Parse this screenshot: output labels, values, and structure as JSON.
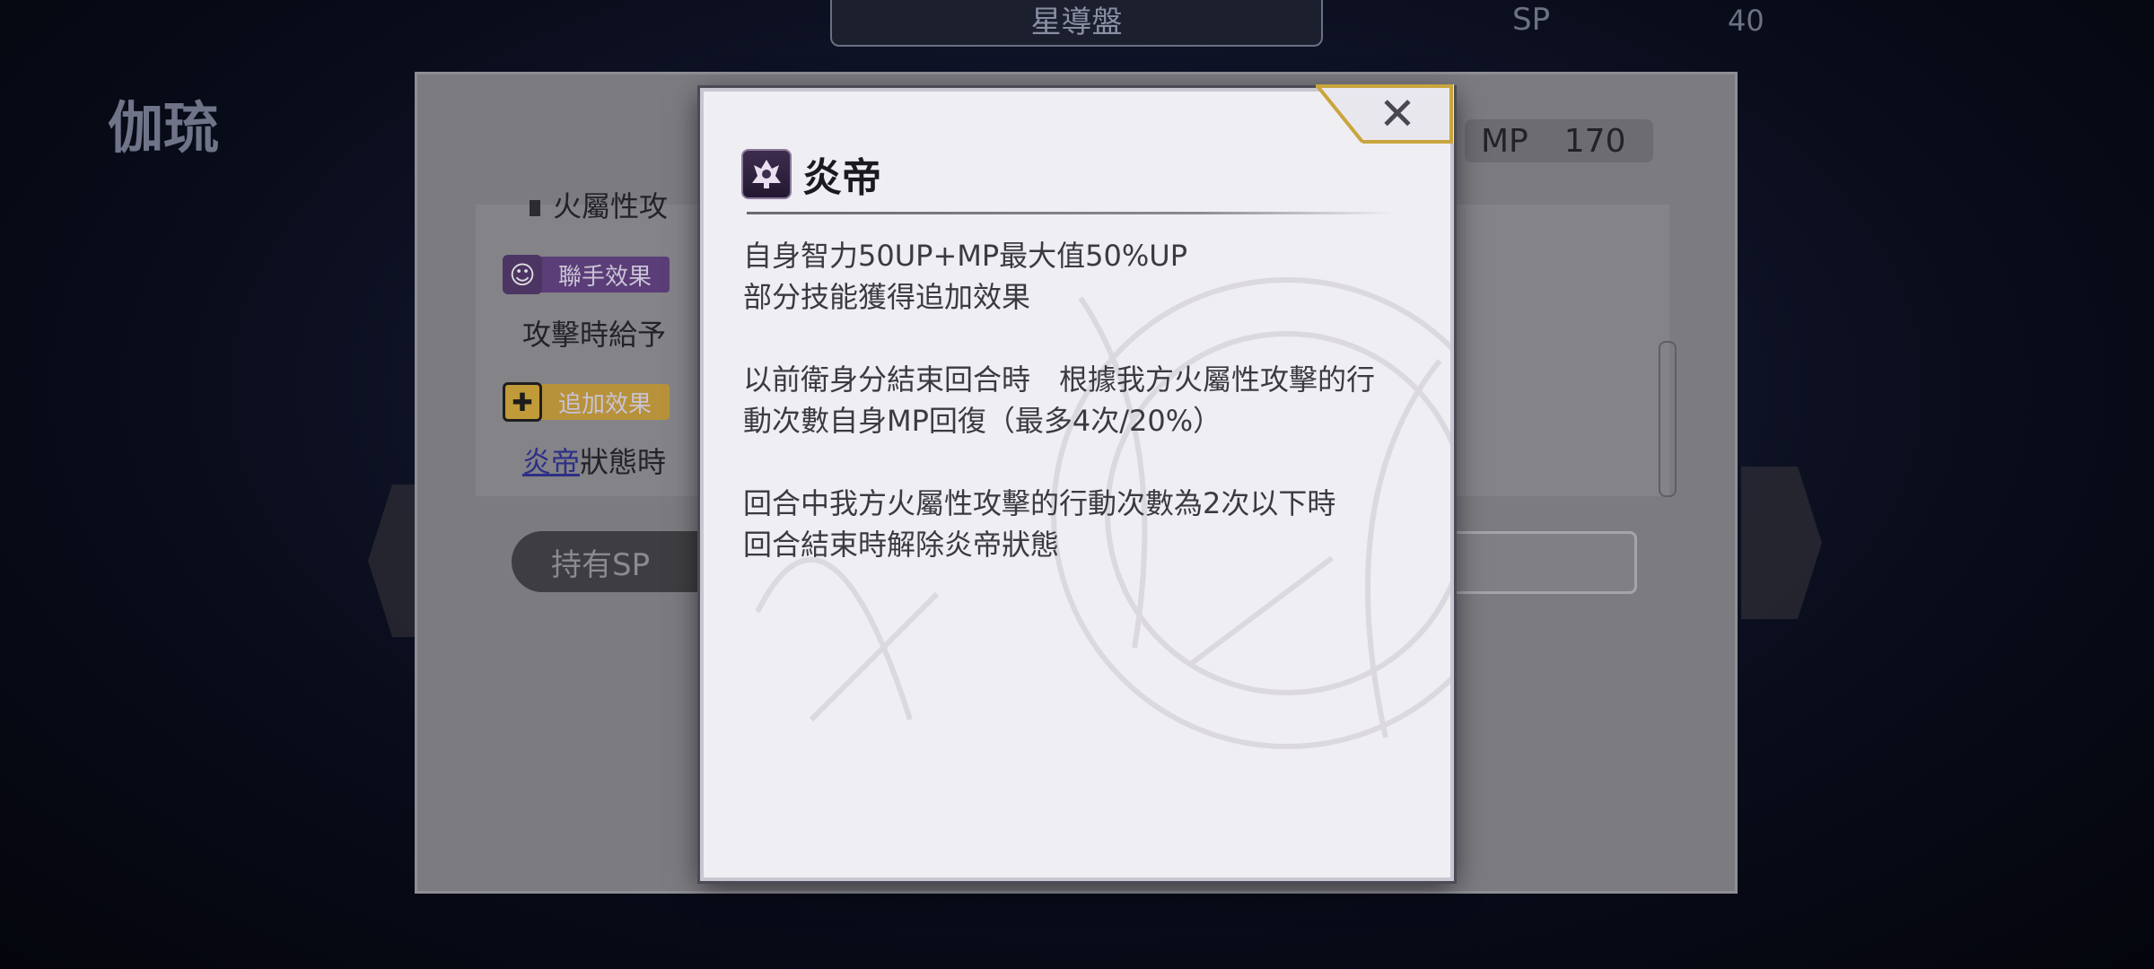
{
  "background": {
    "top_tab_title": "星導盤",
    "sp_label": "SP",
    "sp_value": "40",
    "character_name": "伽琉",
    "character_subtitle": "",
    "mp_label": "MP",
    "mp_value": "170",
    "partial_line_top": "火屬性攻",
    "partial_line_top_right": ")",
    "team_effect_label": "聯手效果",
    "team_effect_text": "攻擊時給予",
    "extra_effect_label": "追加效果",
    "extra_effect_keyword": "炎帝",
    "extra_effect_text": "狀態時",
    "held_sp_label": "持有SP"
  },
  "dialog": {
    "title": "炎帝",
    "icon": "flame-emperor-skill-icon",
    "paragraphs": [
      "自身智力50UP+MP最大值50%UP\n部分技能獲得追加效果",
      "以前衛身分結束回合時　根據我方火屬性攻擊的行動次數自身MP回復（最多4次/20%）",
      "回合中我方火屬性攻擊的行動次數為2次以下時　回合結束時解除炎帝狀態"
    ],
    "close_icon": "close-icon"
  },
  "colors": {
    "dialog_bg": "#efeef3",
    "close_gold": "#c9a53c",
    "team_tag": "#5b3d77",
    "extra_tag": "#b7923a",
    "keyword_link": "#2d2f86"
  }
}
